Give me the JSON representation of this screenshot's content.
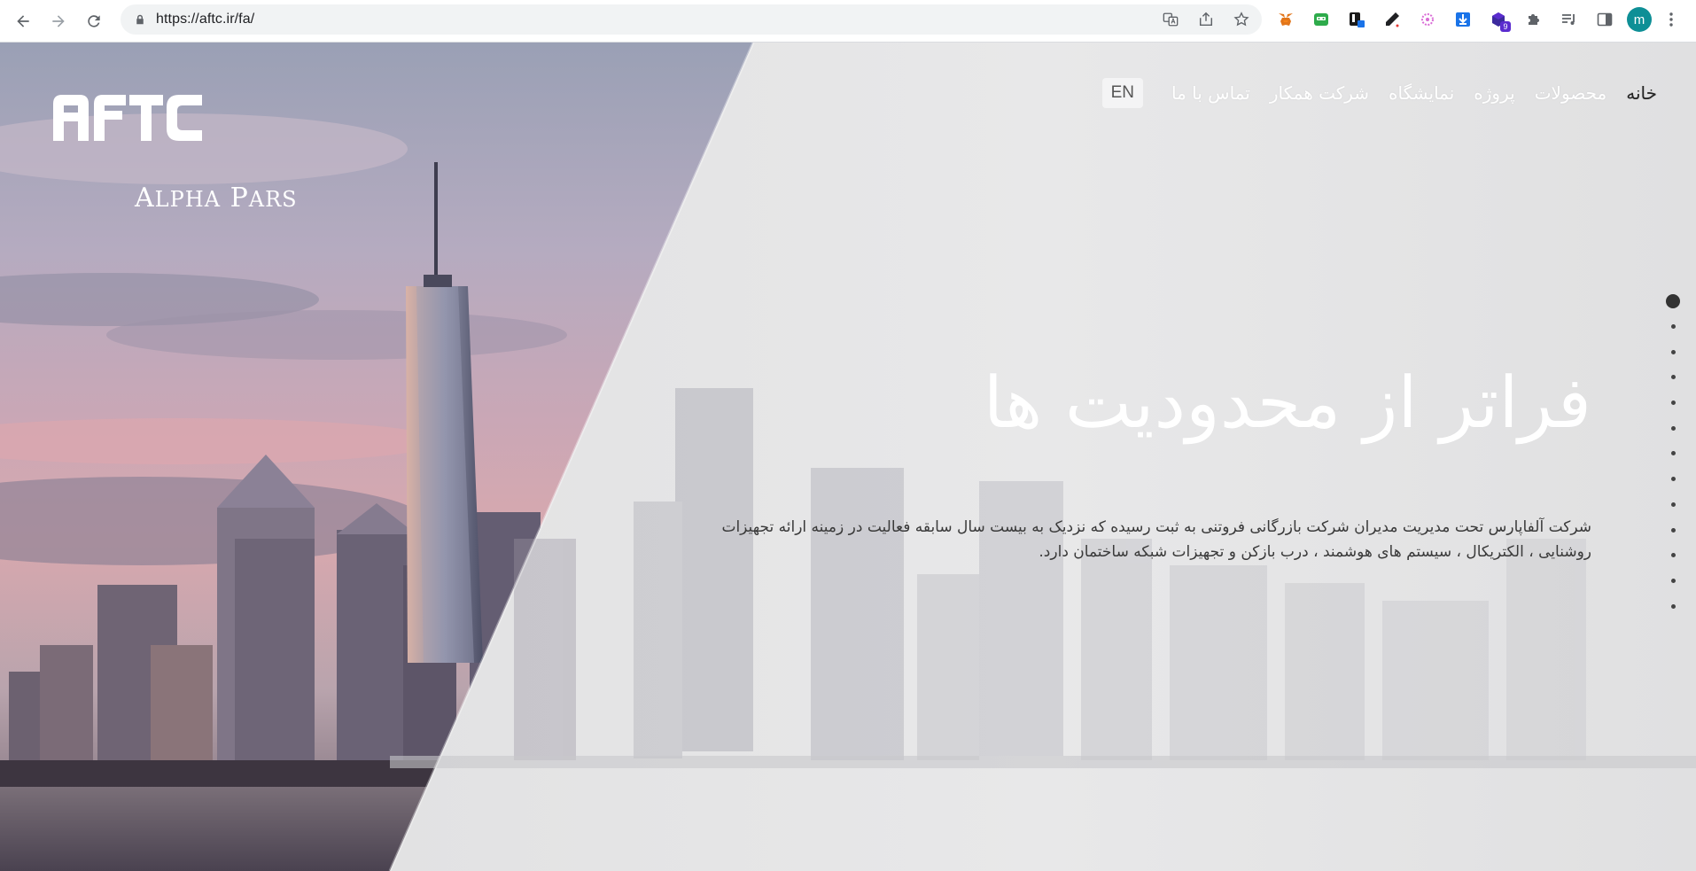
{
  "browser": {
    "url": "https://aftc.ir/fa/",
    "profile_initial": "m",
    "extensions": [
      {
        "name": "metamask-fox-icon",
        "color": "#e2761b"
      },
      {
        "name": "green-robot-icon",
        "color": "#2eab4b"
      },
      {
        "name": "pdf-extension-icon",
        "color": "#1a1a1a"
      },
      {
        "name": "color-picker-icon",
        "color": "#202124"
      },
      {
        "name": "pink-flower-icon",
        "color": "#d96ad6"
      },
      {
        "name": "download-arrow-icon",
        "color": "#1a73e8"
      },
      {
        "name": "purple-cube-icon",
        "color": "#5b2ccf",
        "badge": "9"
      },
      {
        "name": "puzzle-piece-icon",
        "color": "#5f6368"
      },
      {
        "name": "media-playlist-icon",
        "color": "#5f6368"
      },
      {
        "name": "side-panel-icon",
        "color": "#5f6368"
      }
    ]
  },
  "site": {
    "logo": {
      "mark_text": "AFTC",
      "name_initial_1": "A",
      "name_rest_1": "LPHA",
      "name_initial_2": "P",
      "name_rest_2": "ARS"
    },
    "nav": {
      "home": "خانه",
      "products": "محصولات",
      "project": "پروژه",
      "showroom": "نمایشگاه",
      "partners": "شرکت همکار",
      "contact": "تماس با ما",
      "language": "EN"
    },
    "hero": {
      "headline": "فراتر از محدودیت ها",
      "description": "شرکت آلفاپارس تحت مدیریت مدیران شرکت بازرگانی فروتنی به ثبت رسیده که نزدیک به بیست سال سابقه فعالیت در زمینه ارائه تجهیزات روشنایی ، الکتریکال ، سیستم های هوشمند ، درب بازکن و تجهیزات شبکه ساختمان دارد."
    },
    "slider": {
      "slide_count": 13,
      "active_index": 0
    }
  }
}
